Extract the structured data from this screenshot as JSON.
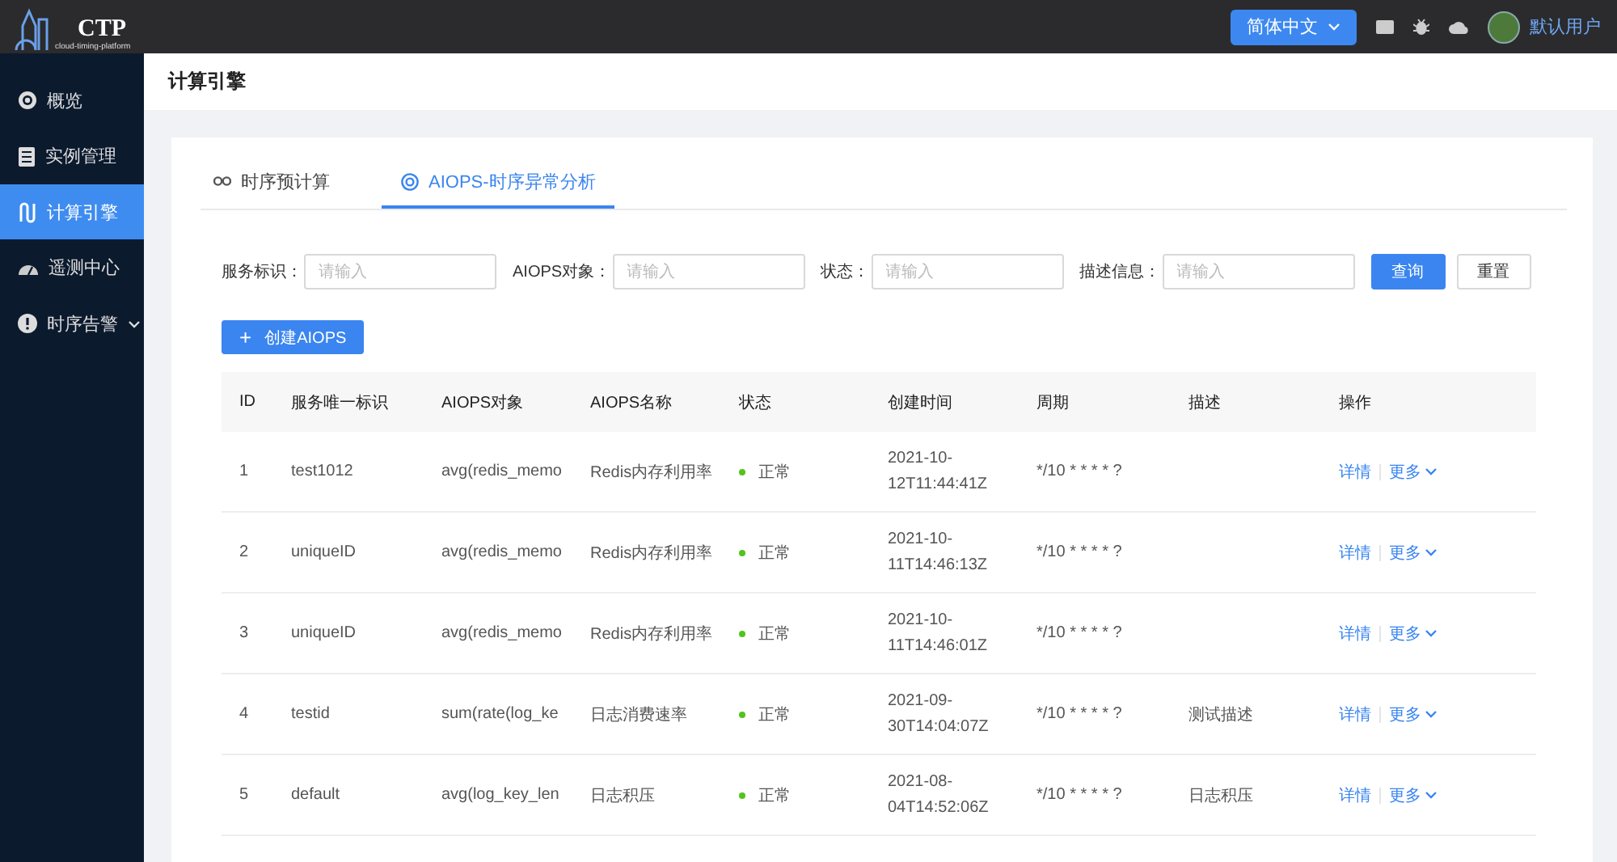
{
  "topbar": {
    "logo_title": "CTP",
    "logo_subtitle": "cloud-timing-platform",
    "language": "简体中文",
    "user": "默认用户"
  },
  "sidebar": {
    "items": [
      {
        "label": "概览",
        "kind": "link",
        "selected": false
      },
      {
        "label": "实例管理",
        "kind": "link",
        "selected": false
      },
      {
        "label": "计算引擎",
        "kind": "link",
        "selected": true
      },
      {
        "label": "遥测中心",
        "kind": "link",
        "selected": false
      },
      {
        "label": "时序告警",
        "kind": "group",
        "selected": false
      }
    ]
  },
  "page": {
    "title": "计算引擎"
  },
  "tabs": [
    {
      "label": "时序预计算",
      "selected": false
    },
    {
      "label": "AIOPS-时序异常分析",
      "selected": true
    }
  ],
  "filters": [
    {
      "label": "服务标识：",
      "placeholder": "请输入"
    },
    {
      "label": "AIOPS对象：",
      "placeholder": "请输入"
    },
    {
      "label": "状态：",
      "placeholder": "请输入"
    },
    {
      "label": "描述信息：",
      "placeholder": "请输入"
    }
  ],
  "filter_buttons": [
    {
      "label": "查询",
      "kind": "primary"
    },
    {
      "label": "重置",
      "kind": "default"
    }
  ],
  "create_button": {
    "icon": "+",
    "label": "创建AIOPS"
  },
  "table": {
    "columns": [
      "ID",
      "服务唯一标识",
      "AIOPS对象",
      "AIOPS名称",
      "状态",
      "创建时间",
      "周期",
      "描述",
      "操作"
    ],
    "rows": [
      {
        "id": "1",
        "service": "test1012",
        "object": "avg(redis_memo",
        "name": "Redis内存利用率",
        "status": "正常",
        "color": "#52c41a",
        "created": [
          "2021-10-",
          "12T11:44:41Z"
        ],
        "period": "*/10 * * * * ?",
        "actions": [
          "详情",
          "更多"
        ]
      },
      {
        "id": "2",
        "service": "uniqueID",
        "object": "avg(redis_memo",
        "name": "Redis内存利用率",
        "status": "正常",
        "color": "#52c41a",
        "created": [
          "2021-10-",
          "11T14:46:13Z"
        ],
        "period": "*/10 * * * * ?",
        "actions": [
          "详情",
          "更多"
        ]
      },
      {
        "id": "3",
        "service": "uniqueID",
        "object": "avg(redis_memo",
        "name": "Redis内存利用率",
        "status": "正常",
        "color": "#52c41a",
        "created": [
          "2021-10-",
          "11T14:46:01Z"
        ],
        "period": "*/10 * * * * ?",
        "actions": [
          "详情",
          "更多"
        ]
      },
      {
        "id": "4",
        "service": "testid",
        "object": "sum(rate(log_ke",
        "name": "日志消费速率",
        "status": "正常",
        "color": "#52c41a",
        "created": [
          "2021-09-",
          "30T14:04:07Z"
        ],
        "period": "*/10 * * * * ?",
        "description": "测试描述",
        "actions": [
          "详情",
          "更多"
        ]
      },
      {
        "id": "5",
        "service": "default",
        "object": "avg(log_key_len",
        "name": "日志积压",
        "status": "正常",
        "color": "#52c41a",
        "created": [
          "2021-08-",
          "04T14:52:06Z"
        ],
        "period": "*/10 * * * * ?",
        "description": "日志积压",
        "actions": [
          "详情",
          "更多"
        ]
      }
    ]
  }
}
